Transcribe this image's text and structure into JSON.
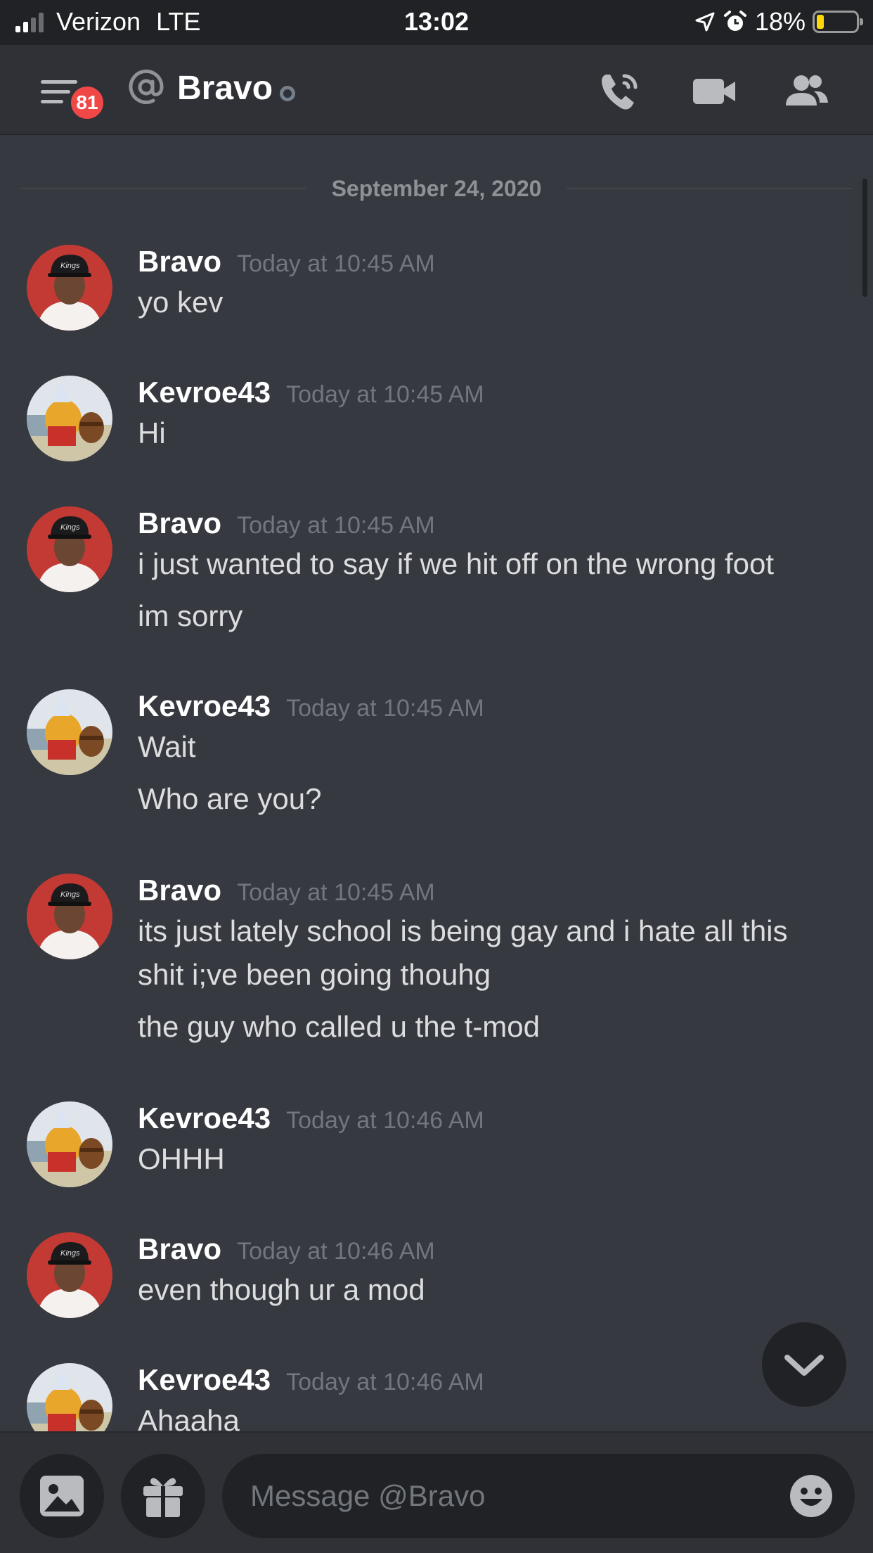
{
  "status_bar": {
    "carrier": "Verizon",
    "network": "LTE",
    "time": "13:02",
    "battery": "18%"
  },
  "header": {
    "title": "Bravo",
    "notification_badge": "81",
    "icons": [
      "menu-icon",
      "at-icon",
      "phone-call-icon",
      "video-camera-icon",
      "members-icon"
    ]
  },
  "chat": {
    "date_divider": "September 24, 2020",
    "messages": [
      {
        "author": "Bravo",
        "timestamp": "Today at 10:45 AM",
        "lines": [
          "yo kev"
        ]
      },
      {
        "author": "Kevroe43",
        "timestamp": "Today at 10:45 AM",
        "lines": [
          "Hi"
        ]
      },
      {
        "author": "Bravo",
        "timestamp": "Today at 10:45 AM",
        "lines": [
          "i just wanted to say if we hit off on the wrong foot",
          "im sorry"
        ]
      },
      {
        "author": "Kevroe43",
        "timestamp": "Today at 10:45 AM",
        "lines": [
          "Wait",
          "Who are you?"
        ]
      },
      {
        "author": "Bravo",
        "timestamp": "Today at 10:45 AM",
        "lines": [
          "its just lately school is being gay and i hate all this",
          "shit i;ve been going thouhg",
          "the guy who called u the t-mod"
        ]
      },
      {
        "author": "Kevroe43",
        "timestamp": "Today at 10:46 AM",
        "lines": [
          "OHHH"
        ]
      },
      {
        "author": "Bravo",
        "timestamp": "Today at 10:46 AM",
        "lines": [
          "even though ur a mod"
        ]
      },
      {
        "author": "Kevroe43",
        "timestamp": "Today at 10:46 AM",
        "lines": [
          "Ahaaha"
        ]
      }
    ]
  },
  "composer": {
    "placeholder": "Message @Bravo",
    "icons": [
      "image-icon",
      "gift-icon",
      "emoji-icon"
    ]
  },
  "colors": {
    "background": "#36393f",
    "header": "#2f3136",
    "input": "#202225",
    "badge": "#f04747",
    "battery_low": "#ffd60a"
  }
}
